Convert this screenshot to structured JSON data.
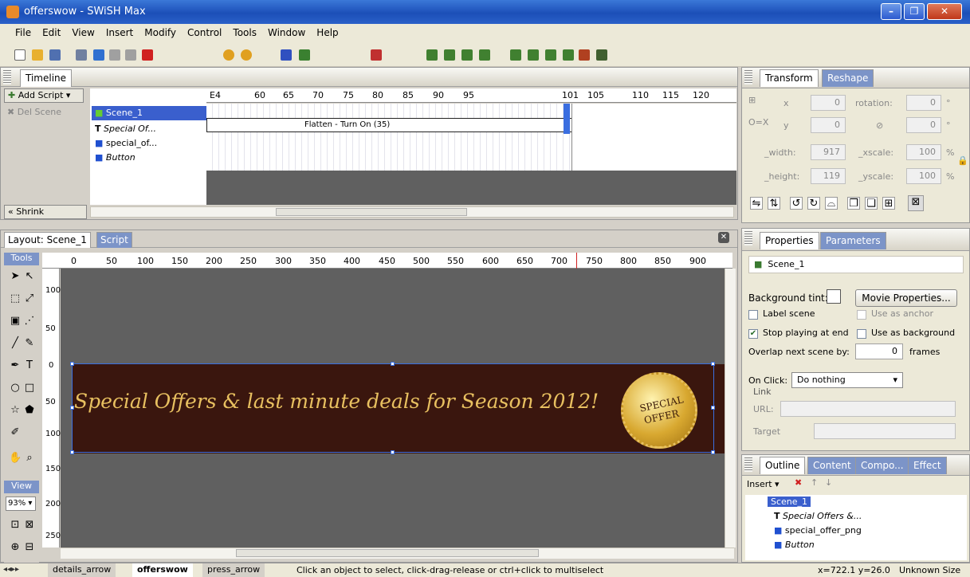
{
  "window": {
    "title": "offerswow - SWiSH Max"
  },
  "menu": [
    "File",
    "Edit",
    "View",
    "Insert",
    "Modify",
    "Control",
    "Tools",
    "Window",
    "Help"
  ],
  "timeline": {
    "tab": "Timeline",
    "add_script": "Add Script",
    "del_scene": "Del Scene",
    "shrink": "Shrink",
    "scene_name": "Scene_1",
    "layers": [
      "Special Of...",
      "special_of...",
      "Button"
    ],
    "frame_numbers": [
      "E4",
      "60",
      "65",
      "70",
      "75",
      "80",
      "85",
      "90",
      "95",
      "101",
      "105",
      "110",
      "115",
      "120"
    ],
    "effect_label": "Flatten - Turn On (35)"
  },
  "layout": {
    "tabs": [
      "Layout: Scene_1",
      "Script"
    ],
    "tools_label": "Tools",
    "view_label": "View",
    "zoom": "93%",
    "ruler_h": [
      "0",
      "50",
      "100",
      "150",
      "200",
      "250",
      "300",
      "350",
      "400",
      "450",
      "500",
      "550",
      "600",
      "650",
      "700",
      "750",
      "800",
      "850",
      "900"
    ],
    "ruler_v": [
      "100",
      "50",
      "0",
      "50",
      "100",
      "150",
      "200",
      "250"
    ],
    "banner_text": "Special Offers & last minute deals for Season 2012!",
    "badge_line1": "SPECIAL",
    "badge_line2": "OFFER",
    "banner_color": "#3a160e",
    "canvas_color": "#606060"
  },
  "transform": {
    "tabs": [
      "Transform",
      "Reshape"
    ],
    "x_label": "x",
    "x": "0",
    "y_label": "y",
    "y": "0",
    "rotation_label": "rotation:",
    "rotation": "0",
    "skew": "0",
    "deg": "°",
    "width_label": "_width:",
    "width": "917",
    "height_label": "_height:",
    "height": "119",
    "xscale_label": "_xscale:",
    "xscale": "100",
    "yscale_label": "_yscale:",
    "yscale": "100",
    "pct": "%"
  },
  "properties": {
    "tabs": [
      "Properties",
      "Parameters"
    ],
    "scene_name": "Scene_1",
    "bg_tint": "Background tint:",
    "movie_props": "Movie Properties...",
    "label_scene": "Label scene",
    "use_anchor": "Use as anchor",
    "stop_playing": "Stop playing at end",
    "use_background": "Use as background",
    "overlap": "Overlap next scene by:",
    "overlap_value": "0",
    "frames": "frames",
    "on_click": "On Click:",
    "on_click_value": "Do nothing",
    "link": "Link",
    "url": "URL:",
    "target": "Target"
  },
  "outline": {
    "tabs": [
      "Outline",
      "Content",
      "Compo...",
      "Effect"
    ],
    "insert": "Insert",
    "items": [
      "Scene_1",
      "Special Offers &...",
      "special_offer_png",
      "Button"
    ]
  },
  "bottom": {
    "tabs": [
      "details_arrow",
      "offerswow",
      "press_arrow"
    ],
    "status": "Click an object to select, click-drag-release or ctrl+click to multiselect",
    "coords": "x=722.1 y=26.0",
    "size": "Unknown Size"
  },
  "accent": "#3a6ee0"
}
